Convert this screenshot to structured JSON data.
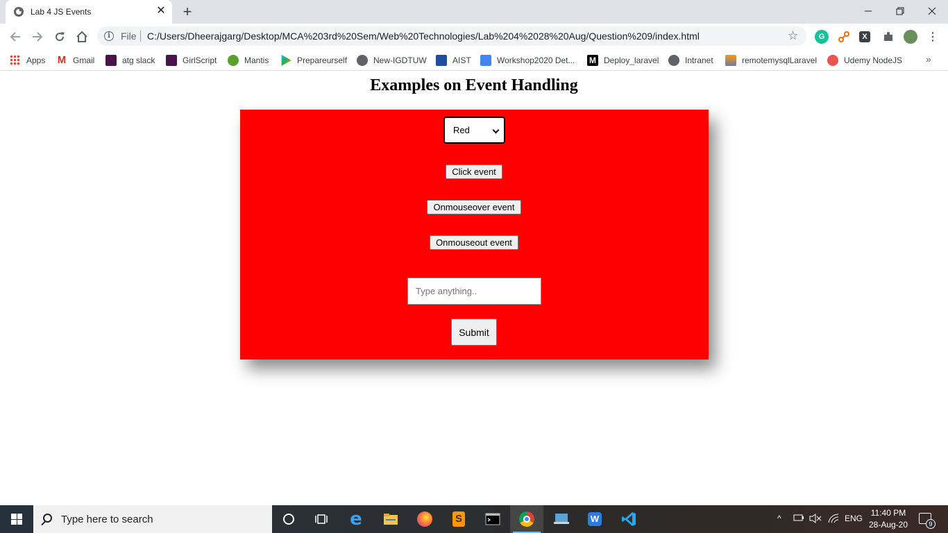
{
  "browser": {
    "tab_title": "Lab 4 JS Events",
    "tab_close": "✕",
    "new_tab": "+",
    "window_controls": {
      "minimize": "—",
      "restore": "❐",
      "close": "✕"
    },
    "omnibox": {
      "scheme_label": "File",
      "url": "C:/Users/Dheerajgarg/Desktop/MCA%203rd%20Sem/Web%20Technologies/Lab%204%2028%20Aug/Question%209/index.html"
    },
    "extensions": [
      "grammarly-icon",
      "mindmap-icon",
      "excel-icon",
      "puzzle-icon",
      "profile-avatar"
    ],
    "bookmarks": [
      {
        "label": "Apps",
        "icon": "apps-grid-icon"
      },
      {
        "label": "Gmail",
        "icon": "gmail-icon"
      },
      {
        "label": "atg slack",
        "icon": "slack-icon"
      },
      {
        "label": "GirlScript",
        "icon": "slack-icon"
      },
      {
        "label": "Mantis",
        "icon": "mantis-icon"
      },
      {
        "label": "Prepareurself",
        "icon": "play-store-icon"
      },
      {
        "label": "New-IGDTUW",
        "icon": "globe-icon"
      },
      {
        "label": "AIST",
        "icon": "aist-icon"
      },
      {
        "label": "Workshop2020 Det...",
        "icon": "docs-icon"
      },
      {
        "label": "Deploy_laravel",
        "icon": "medium-icon"
      },
      {
        "label": "Intranet",
        "icon": "globe-icon"
      },
      {
        "label": "remotemysqlLaravel",
        "icon": "pma-icon"
      },
      {
        "label": "Udemy NodeJS",
        "icon": "udemy-icon"
      }
    ],
    "bookmarks_overflow": "»"
  },
  "page": {
    "title": "Examples on Event Handling",
    "panel_color": "#ff0000",
    "color_select": {
      "selected": "Red"
    },
    "buttons": {
      "click": "Click event",
      "mouseover": "Onmouseover event",
      "mouseout": "Onmouseout event",
      "submit": "Submit"
    },
    "text_input": {
      "placeholder": "Type anything.."
    }
  },
  "taskbar": {
    "search_placeholder": "Type here to search",
    "apps": [
      "cortana-icon",
      "task-view-icon",
      "edge-icon",
      "file-explorer-icon",
      "firefox-icon",
      "sublime-icon",
      "terminal-icon",
      "chrome-icon",
      "desktop-app-icon",
      "wps-writer-icon",
      "vscode-icon"
    ],
    "language": "ENG",
    "time": "11:40 PM",
    "date": "28-Aug-20",
    "notification_count": "9"
  }
}
